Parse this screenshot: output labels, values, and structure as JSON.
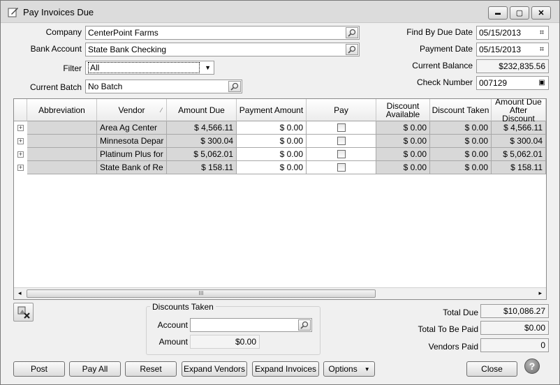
{
  "window": {
    "title": "Pay Invoices Due",
    "minimize": "▬",
    "maximize": "▢",
    "close": "✕"
  },
  "form": {
    "company_label": "Company",
    "company_value": "CenterPoint Farms",
    "bank_label": "Bank Account",
    "bank_value": "State Bank Checking",
    "filter_label": "Filter",
    "filter_value": "All",
    "batch_label": "Current Batch",
    "batch_value": "No Batch",
    "find_label": "Find By Due Date",
    "find_value": "05/15/2013",
    "paydate_label": "Payment Date",
    "paydate_value": "05/15/2013",
    "balance_label": "Current Balance",
    "balance_value": "$232,835.56",
    "check_label": "Check Number",
    "check_value": "007129"
  },
  "grid": {
    "columns": [
      "Abbreviation",
      "Vendor",
      "Amount Due",
      "Payment Amount",
      "Pay",
      "Discount Available",
      "Discount Taken",
      "Amount Due After Discount"
    ],
    "rows": [
      {
        "abbr": "",
        "vendor": "Area Ag Center",
        "due": "$ 4,566.11",
        "payment": "$ 0.00",
        "disc_avail": "$ 0.00",
        "disc_taken": "$ 0.00",
        "after": "$ 4,566.11"
      },
      {
        "abbr": "",
        "vendor": "Minnesota Depar",
        "due": "$ 300.04",
        "payment": "$ 0.00",
        "disc_avail": "$ 0.00",
        "disc_taken": "$ 0.00",
        "after": "$ 300.04"
      },
      {
        "abbr": "",
        "vendor": "Platinum Plus for",
        "due": "$ 5,062.01",
        "payment": "$ 0.00",
        "disc_avail": "$ 0.00",
        "disc_taken": "$ 0.00",
        "after": "$ 5,062.01"
      },
      {
        "abbr": "",
        "vendor": "State Bank of Re",
        "due": "$ 158.11",
        "payment": "$ 0.00",
        "disc_avail": "$ 0.00",
        "disc_taken": "$ 0.00",
        "after": "$ 158.11"
      }
    ],
    "scroll_thumb": "III"
  },
  "discounts": {
    "title": "Discounts Taken",
    "account_label": "Account",
    "account_value": "",
    "amount_label": "Amount",
    "amount_value": "$0.00"
  },
  "totals": {
    "due_label": "Total Due",
    "due_value": "$10,086.27",
    "paid_label": "Total To Be Paid",
    "paid_value": "$0.00",
    "vendors_label": "Vendors Paid",
    "vendors_value": "0"
  },
  "buttons": {
    "post": "Post",
    "pay_all": "Pay All",
    "reset": "Reset",
    "expand_vendors": "Expand Vendors",
    "expand_invoices": "Expand Invoices",
    "options": "Options",
    "close": "Close",
    "help": "?"
  }
}
